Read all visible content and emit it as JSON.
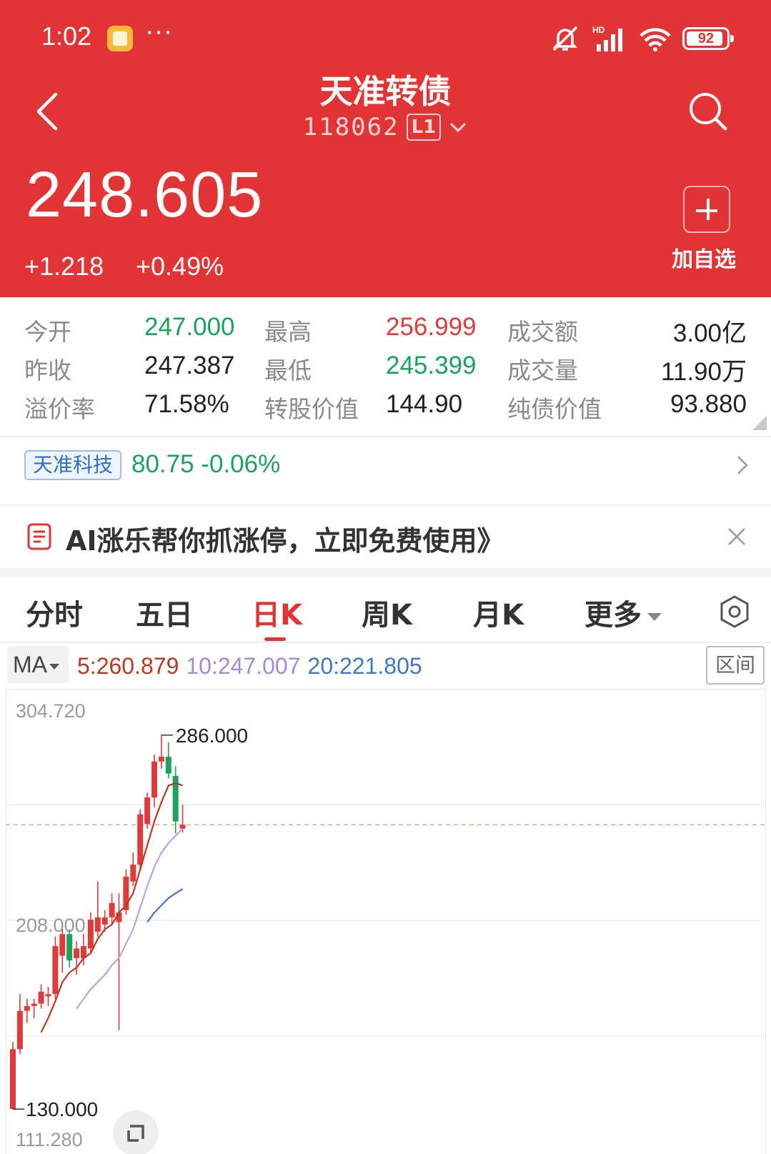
{
  "status": {
    "time": "1:02",
    "dots": "···",
    "battery": "92",
    "battery_level": 0.92,
    "network_label": "HD"
  },
  "header": {
    "title": "天准转债",
    "code": "118062",
    "level": "L1",
    "price": "248.605",
    "change": "+1.218",
    "change_pct": "+0.49%",
    "add_label": "加自选",
    "bg_color": "#e23434"
  },
  "quote": [
    [
      {
        "label": "今开",
        "value": "247.000",
        "color": "green"
      },
      {
        "label": "最高",
        "value": "256.999",
        "color": "red"
      },
      {
        "label": "成交额",
        "value": "3.00亿",
        "color": "dark"
      }
    ],
    [
      {
        "label": "昨收",
        "value": "247.387",
        "color": "dark"
      },
      {
        "label": "最低",
        "value": "245.399",
        "color": "green"
      },
      {
        "label": "成交量",
        "value": "11.90万",
        "color": "dark"
      }
    ],
    [
      {
        "label": "溢价率",
        "value": "71.58%",
        "color": "dark"
      },
      {
        "label": "转股价值",
        "value": "144.90",
        "color": "dark"
      },
      {
        "label": "纯债价值",
        "value": "93.880",
        "color": "dark"
      }
    ]
  ],
  "related": {
    "name": "天准科技",
    "quote": "80.75 -0.06%"
  },
  "ad": {
    "text": "AI涨乐帮你抓涨停，立即免费使用》"
  },
  "tabs": [
    {
      "label": "分时",
      "active": false
    },
    {
      "label": "五日",
      "active": false
    },
    {
      "label": "日K",
      "active": true
    },
    {
      "label": "周K",
      "active": false
    },
    {
      "label": "月K",
      "active": false
    },
    {
      "label": "更多",
      "active": false
    }
  ],
  "indicator": {
    "name": "MA",
    "ma5": "5:260.879",
    "ma10": "10:247.007",
    "ma20": "20:221.805",
    "range_label": "区间"
  },
  "chart_data": {
    "type": "candlestick",
    "y_axis_labels": [
      "304.720",
      "208.000",
      "111.280"
    ],
    "ylim": [
      111.28,
      304.72
    ],
    "annotations": {
      "max": "286.000",
      "min": "130.000"
    },
    "last_close": 248.605,
    "up_color": "#e03b3b",
    "down_color": "#1aa35c",
    "candles": [
      {
        "o": 130.0,
        "h": 158.0,
        "l": 130.0,
        "c": 155.0
      },
      {
        "o": 155.0,
        "h": 178.0,
        "l": 153.0,
        "c": 171.0
      },
      {
        "o": 171.0,
        "h": 176.0,
        "l": 166.0,
        "c": 173.0
      },
      {
        "o": 173.0,
        "h": 176.0,
        "l": 168.0,
        "c": 174.0
      },
      {
        "o": 174.0,
        "h": 182.0,
        "l": 172.0,
        "c": 179.0
      },
      {
        "o": 177.0,
        "h": 181.0,
        "l": 173.0,
        "c": 178.0
      },
      {
        "o": 178.0,
        "h": 202.0,
        "l": 176.0,
        "c": 198.0
      },
      {
        "o": 194.0,
        "h": 205.0,
        "l": 187.0,
        "c": 203.0
      },
      {
        "o": 203.0,
        "h": 205.0,
        "l": 189.0,
        "c": 192.0
      },
      {
        "o": 193.0,
        "h": 200.0,
        "l": 186.0,
        "c": 197.0
      },
      {
        "o": 193.0,
        "h": 203.0,
        "l": 190.0,
        "c": 198.0
      },
      {
        "o": 197.0,
        "h": 212.0,
        "l": 195.0,
        "c": 209.0
      },
      {
        "o": 204.0,
        "h": 225.0,
        "l": 202.0,
        "c": 210.0
      },
      {
        "o": 207.0,
        "h": 213.0,
        "l": 204.0,
        "c": 210.0
      },
      {
        "o": 210.0,
        "h": 220.0,
        "l": 207.0,
        "c": 216.0
      },
      {
        "o": 208.0,
        "h": 220.0,
        "l": 163.0,
        "c": 212.0
      },
      {
        "o": 213.0,
        "h": 230.0,
        "l": 211.0,
        "c": 227.0
      },
      {
        "o": 225.0,
        "h": 237.0,
        "l": 223.0,
        "c": 232.0
      },
      {
        "o": 232.0,
        "h": 255.0,
        "l": 230.0,
        "c": 253.0
      },
      {
        "o": 249.0,
        "h": 262.0,
        "l": 247.0,
        "c": 260.0
      },
      {
        "o": 260.0,
        "h": 278.0,
        "l": 256.0,
        "c": 275.0
      },
      {
        "o": 275.0,
        "h": 286.0,
        "l": 272.0,
        "c": 277.0
      },
      {
        "o": 277.0,
        "h": 283.0,
        "l": 268.0,
        "c": 270.0
      },
      {
        "o": 269.0,
        "h": 273.0,
        "l": 245.0,
        "c": 250.0
      },
      {
        "o": 247.0,
        "h": 257.0,
        "l": 245.4,
        "c": 248.6
      }
    ],
    "ma5": [
      [
        4,
        162.0
      ],
      [
        5,
        168.0
      ],
      [
        6,
        175.0
      ],
      [
        7,
        183.0
      ],
      [
        8,
        187.0
      ],
      [
        9,
        189.0
      ],
      [
        10,
        193.0
      ],
      [
        11,
        195.0
      ],
      [
        12,
        201.0
      ],
      [
        13,
        205.0
      ],
      [
        14,
        207.0
      ],
      [
        15,
        212.0
      ],
      [
        16,
        215.0
      ],
      [
        17,
        220.0
      ],
      [
        18,
        230.0
      ],
      [
        19,
        240.0
      ],
      [
        20,
        250.0
      ],
      [
        21,
        258.0
      ],
      [
        22,
        265.0
      ],
      [
        23,
        266.0
      ],
      [
        24,
        265.0
      ]
    ],
    "ma10": [
      [
        9,
        172.0
      ],
      [
        10,
        176.0
      ],
      [
        11,
        180.0
      ],
      [
        12,
        183.0
      ],
      [
        13,
        186.0
      ],
      [
        14,
        190.0
      ],
      [
        15,
        193.0
      ],
      [
        16,
        199.0
      ],
      [
        17,
        205.0
      ],
      [
        18,
        214.0
      ],
      [
        19,
        223.0
      ],
      [
        20,
        231.0
      ],
      [
        21,
        237.0
      ],
      [
        22,
        241.0
      ],
      [
        23,
        244.0
      ],
      [
        24,
        247.0
      ]
    ],
    "ma20": [
      [
        19,
        208.0
      ],
      [
        20,
        212.0
      ],
      [
        21,
        215.0
      ],
      [
        22,
        218.0
      ],
      [
        23,
        220.0
      ],
      [
        24,
        221.8
      ]
    ]
  }
}
